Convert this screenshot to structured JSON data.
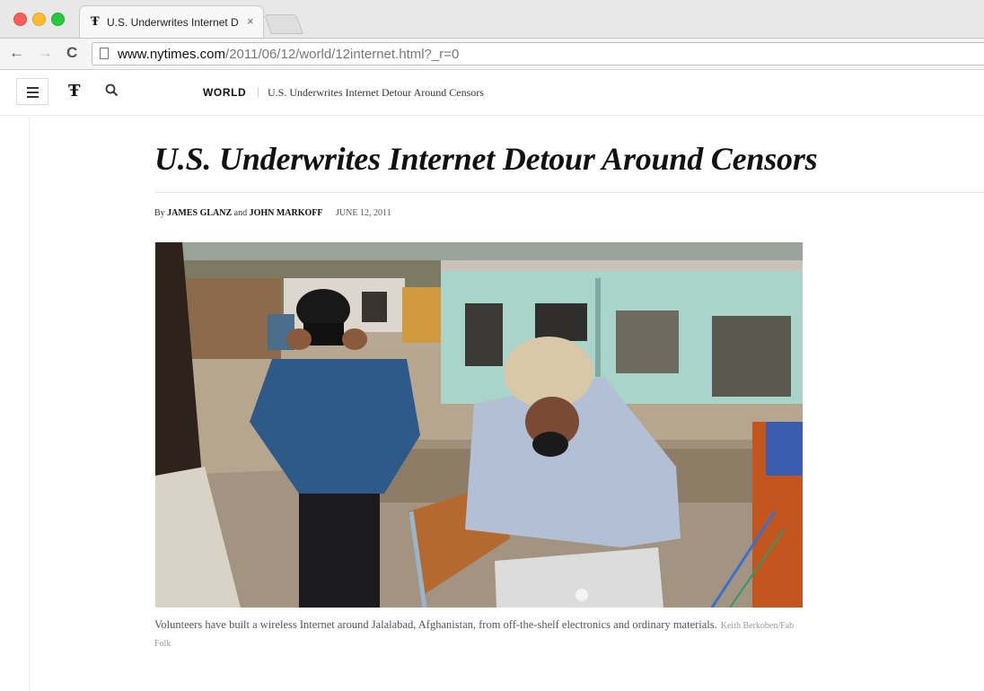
{
  "browser": {
    "tab_title": "U.S. Underwrites Internet D",
    "tab_favicon": "Ŧ",
    "close_glyph": "×",
    "back_glyph": "←",
    "forward_glyph": "→",
    "reload_glyph": "C",
    "url_host": "www.nytimes.com",
    "url_path": "/2011/06/12/world/12internet.html?_r=0"
  },
  "header": {
    "logo": "Ŧ",
    "section": "WORLD",
    "separator": "|",
    "breadcrumb_title": "U.S. Underwrites Internet Detour Around Censors"
  },
  "article": {
    "headline": "U.S. Underwrites Internet Detour Around Censors",
    "byline_prefix": "By",
    "author1": "JAMES GLANZ",
    "byline_and": "and",
    "author2": "JOHN MARKOFF",
    "date": "JUNE 12, 2011",
    "caption": "Volunteers have built a wireless Internet around Jalalabad, Afghanistan, from off-the-shelf electronics and ordinary materials.",
    "photo_credit": "Keith Berkoben/Fab Folk"
  },
  "icons": {
    "menu": "hamburger-icon",
    "search": "search-icon",
    "logo": "nyt-logo-icon",
    "favicon": "nyt-favicon-icon",
    "page": "page-icon"
  },
  "colors": {
    "traffic_red": "#fc5f57",
    "traffic_yellow": "#fdbc2e",
    "traffic_green": "#28c840",
    "headline": "#111111",
    "caption": "#555555"
  }
}
